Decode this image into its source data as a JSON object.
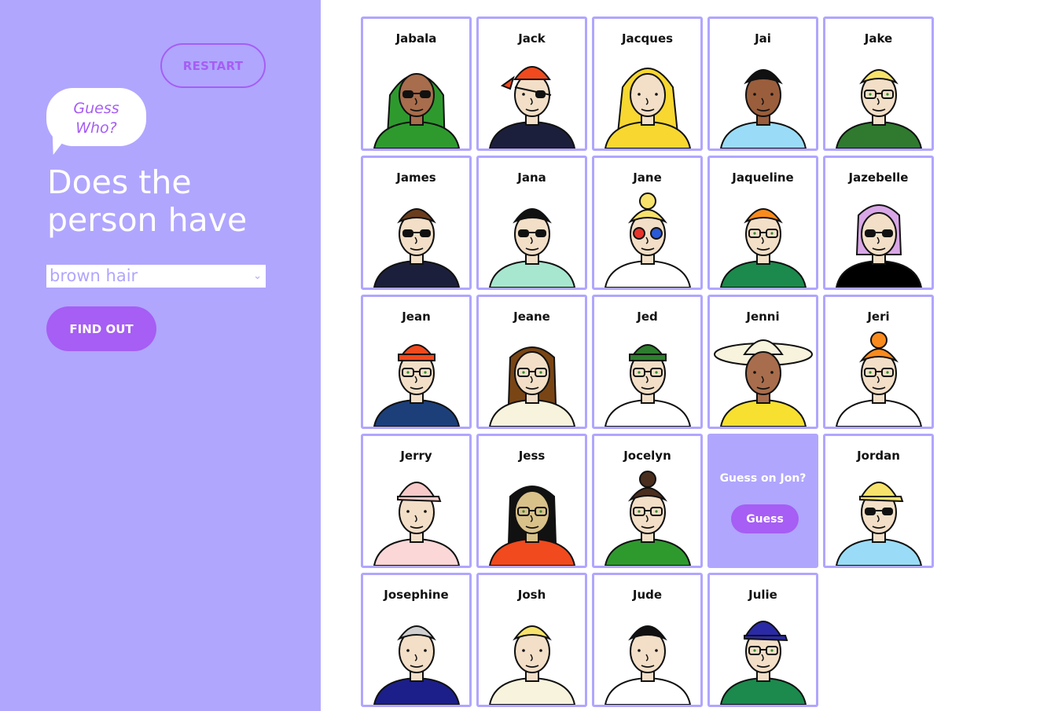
{
  "sidebar": {
    "restart_label": "RESTART",
    "logo_line1": "Guess",
    "logo_line2": "Who?",
    "question": "Does the person have",
    "select_value": "brown hair",
    "find_out_label": "FIND OUT"
  },
  "guess_card": {
    "text": "Guess on Jon?",
    "button_label": "Guess"
  },
  "characters": [
    {
      "name": "Jabala",
      "skin": "#a86d4c",
      "hair": "#2e9a2e",
      "hair_style": "hijab",
      "shirt": "#2e9a2e",
      "glasses": "sunglasses"
    },
    {
      "name": "Jack",
      "skin": "#f3dfc7",
      "hair": "#f04a1e",
      "hair_style": "bandana",
      "shirt": "#1c1f3b",
      "glasses": "eyepatch"
    },
    {
      "name": "Jacques",
      "skin": "#f3dfc7",
      "hair": "#f7d730",
      "hair_style": "raincoat",
      "shirt": "#f7d730",
      "glasses": "none"
    },
    {
      "name": "Jai",
      "skin": "#9a5e3c",
      "hair": "#111111",
      "hair_style": "short",
      "shirt": "#9adcf7",
      "glasses": "none"
    },
    {
      "name": "Jake",
      "skin": "#f3dfc7",
      "hair": "#f7e36c",
      "hair_style": "short",
      "shirt": "#2f7a2f",
      "glasses": "glasses"
    },
    {
      "name": "James",
      "skin": "#f3dfc7",
      "hair": "#6b3d1e",
      "hair_style": "short",
      "shirt": "#1c1f3b",
      "glasses": "sunglasses"
    },
    {
      "name": "Jana",
      "skin": "#f3dfc7",
      "hair": "#111111",
      "hair_style": "short",
      "shirt": "#a7e6cf",
      "glasses": "sunglasses"
    },
    {
      "name": "Jane",
      "skin": "#f3dfc7",
      "hair": "#f7e36c",
      "hair_style": "bun",
      "shirt": "#ffffff",
      "glasses": "colored"
    },
    {
      "name": "Jaqueline",
      "skin": "#f3dfc7",
      "hair": "#f98b1e",
      "hair_style": "short",
      "shirt": "#1b8a4c",
      "glasses": "glasses"
    },
    {
      "name": "Jazebelle",
      "skin": "#f3dfc7",
      "hair": "#d9a7e6",
      "hair_style": "bob",
      "shirt": "#000000",
      "glasses": "sunglasses"
    },
    {
      "name": "Jean",
      "skin": "#f3dfc7",
      "hair": "#f04a1e",
      "hair_style": "beanie",
      "shirt": "#1c3f7a",
      "glasses": "glasses"
    },
    {
      "name": "Jeane",
      "skin": "#f3dfc7",
      "hair": "#7a4514",
      "hair_style": "long",
      "shirt": "#f7f3dc",
      "glasses": "glasses"
    },
    {
      "name": "Jed",
      "skin": "#f3dfc7",
      "hair": "#2e7d2e",
      "hair_style": "beanie",
      "shirt": "#ffffff",
      "glasses": "glasses"
    },
    {
      "name": "Jenni",
      "skin": "#a86d4c",
      "hair": "#f7f3dc",
      "hair_style": "sunhat",
      "shirt": "#f7e030",
      "glasses": "none"
    },
    {
      "name": "Jeri",
      "skin": "#f3dfc7",
      "hair": "#f98b1e",
      "hair_style": "bun",
      "shirt": "#ffffff",
      "glasses": "glasses"
    },
    {
      "name": "Jerry",
      "skin": "#f3dfc7",
      "hair": "#f7c9c9",
      "hair_style": "cap",
      "shirt": "#fbd7d7",
      "glasses": "none"
    },
    {
      "name": "Jess",
      "skin": "#d9c18a",
      "hair": "#111111",
      "hair_style": "long",
      "shirt": "#f04a1e",
      "glasses": "glasses"
    },
    {
      "name": "Jocelyn",
      "skin": "#f3dfc7",
      "hair": "#4a2e1e",
      "hair_style": "bun",
      "shirt": "#2e9a2e",
      "glasses": "glasses"
    },
    {
      "name": "Jordan",
      "skin": "#f3dfc7",
      "hair": "#f7e36c",
      "hair_style": "cap",
      "shirt": "#9adcf7",
      "glasses": "sunglasses"
    },
    {
      "name": "Josephine",
      "skin": "#f3dfc7",
      "hair": "#d0d0d0",
      "hair_style": "short",
      "shirt": "#1c1f8a",
      "glasses": "none"
    },
    {
      "name": "Josh",
      "skin": "#f3dfc7",
      "hair": "#f7e36c",
      "hair_style": "short",
      "shirt": "#f7f3dc",
      "glasses": "none"
    },
    {
      "name": "Jude",
      "skin": "#f3dfc7",
      "hair": "#111111",
      "hair_style": "short",
      "shirt": "#ffffff",
      "glasses": "none"
    },
    {
      "name": "Julie",
      "skin": "#f3dfc7",
      "hair": "#2a2aa6",
      "hair_style": "cap",
      "shirt": "#1b8a4c",
      "glasses": "glasses"
    }
  ],
  "grid_slots": [
    "Jabala",
    "Jack",
    "Jacques",
    "Jai",
    "Jake",
    "James",
    "Jana",
    "Jane",
    "Jaqueline",
    "Jazebelle",
    "Jean",
    "Jeane",
    "Jed",
    "Jenni",
    "Jeri",
    "Jerry",
    "Jess",
    "Jocelyn",
    "__guess__",
    "Jordan",
    "Josephine",
    "Josh",
    "Jude",
    "Julie"
  ]
}
